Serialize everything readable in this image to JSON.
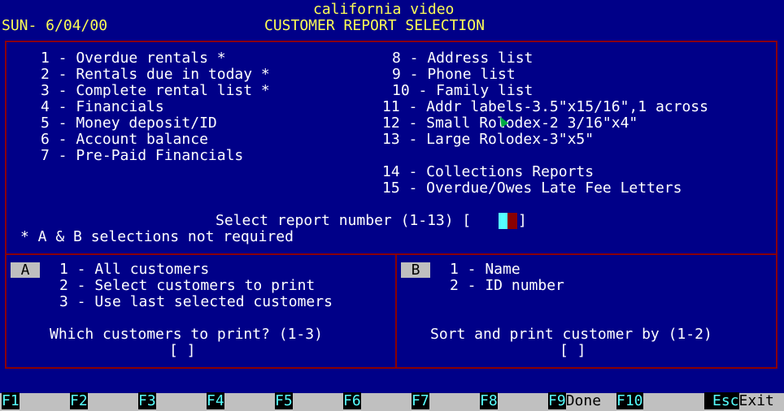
{
  "header": {
    "app_title": "california video",
    "date": "SUN- 6/04/00",
    "screen_title": "CUSTOMER REPORT SELECTION"
  },
  "reports_left": [
    "1 - Overdue rentals *",
    "2 - Rentals due in today *",
    "3 - Complete rental list *",
    "4 - Financials",
    "5 - Money deposit/ID",
    "6 - Account balance",
    "7 - Pre-Paid Financials"
  ],
  "reports_right": [
    "8 - Address list",
    "9 - Phone list",
    "10 - Family list",
    "11 - Addr labels-3.5\"x15/16\",1 across",
    "12 - Small Rolodex-2 3/16\"x4\"",
    "13 - Large Rolodex-3\"x5\"",
    "14 - Collections Reports",
    "15 - Overdue/Owes Late Fee Letters"
  ],
  "select_prompt": "Select report number (1-13) [",
  "select_close": "]",
  "note": "* A & B selections not required",
  "section_a": {
    "tag": "A",
    "options": [
      "1 - All customers",
      "2 - Select customers to print",
      "3 - Use last selected customers"
    ],
    "prompt": "Which customers to print? (1-3)",
    "input": "[ ]"
  },
  "section_b": {
    "tag": "B",
    "options": [
      "1 - Name",
      "2 - ID number"
    ],
    "prompt": "Sort and print customer by (1-2)",
    "input": "[ ]"
  },
  "function_keys": [
    {
      "key": "F1",
      "label": ""
    },
    {
      "key": "F2",
      "label": ""
    },
    {
      "key": "F3",
      "label": ""
    },
    {
      "key": "F4",
      "label": ""
    },
    {
      "key": "F5",
      "label": ""
    },
    {
      "key": "F6",
      "label": ""
    },
    {
      "key": "F7",
      "label": ""
    },
    {
      "key": "F8",
      "label": ""
    },
    {
      "key": "F9",
      "label": "Done"
    },
    {
      "key": "F10",
      "label": ""
    },
    {
      "key": "Esc",
      "label": "Exit"
    }
  ],
  "colors": {
    "background": "#000088",
    "frame": "#8a0000",
    "title": "#ffff55",
    "fkey_number": "#55ffff"
  }
}
